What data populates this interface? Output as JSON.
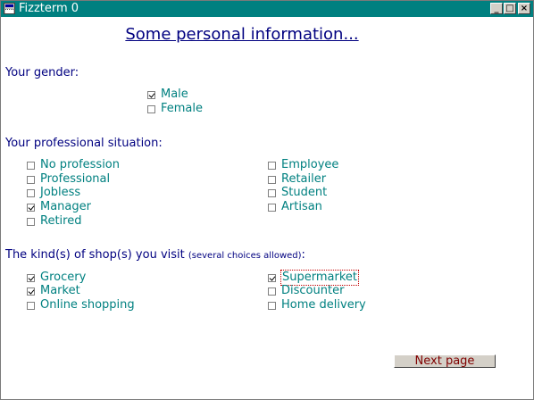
{
  "window": {
    "title": "Fizzterm 0",
    "buttons": {
      "minimize": "_",
      "maximize": "□",
      "close": "×"
    }
  },
  "page_title": "Some personal information...",
  "gender": {
    "label": "Your gender:",
    "options": [
      {
        "label": "Male",
        "checked": true
      },
      {
        "label": "Female",
        "checked": false
      }
    ]
  },
  "profession": {
    "label": "Your professional situation:",
    "options": [
      {
        "label": "No profession",
        "checked": false
      },
      {
        "label": "Professional",
        "checked": false
      },
      {
        "label": "Jobless",
        "checked": false
      },
      {
        "label": "Manager",
        "checked": true
      },
      {
        "label": "Retired",
        "checked": false
      },
      {
        "label": "Employee",
        "checked": false
      },
      {
        "label": "Retailer",
        "checked": false
      },
      {
        "label": "Student",
        "checked": false
      },
      {
        "label": "Artisan",
        "checked": false
      }
    ]
  },
  "shops": {
    "label": "The kind(s) of shop(s) you visit ",
    "note": "(several choices allowed)",
    "suffix": ":",
    "options": [
      {
        "label": "Grocery",
        "checked": true
      },
      {
        "label": "Market",
        "checked": true
      },
      {
        "label": "Online shopping",
        "checked": false
      },
      {
        "label": "Supermarket",
        "checked": true,
        "focused": true
      },
      {
        "label": "Discounter",
        "checked": false
      },
      {
        "label": "Home delivery",
        "checked": false
      }
    ]
  },
  "next_button": "Next page"
}
